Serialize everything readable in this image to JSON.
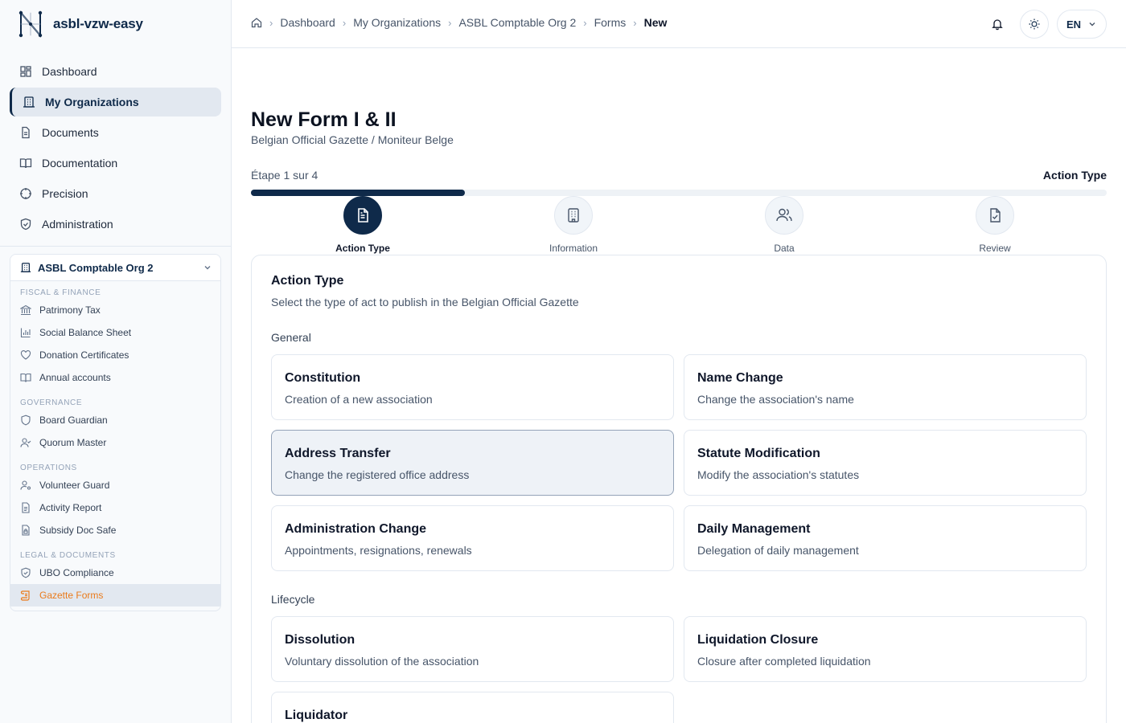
{
  "app": {
    "name": "asbl-vzw-easy"
  },
  "sidebar": {
    "nav": [
      {
        "label": "Dashboard",
        "icon": "grid-icon"
      },
      {
        "label": "My Organizations",
        "icon": "building-icon",
        "active": true
      },
      {
        "label": "Documents",
        "icon": "file-icon"
      },
      {
        "label": "Documentation",
        "icon": "book-icon"
      },
      {
        "label": "Precision",
        "icon": "crosshair-icon"
      },
      {
        "label": "Administration",
        "icon": "shield-icon"
      }
    ],
    "org": {
      "name": "ASBL Comptable Org 2",
      "sections": [
        {
          "label": "FISCAL & FINANCE",
          "items": [
            "Patrimony Tax",
            "Social Balance Sheet",
            "Donation Certificates",
            "Annual accounts"
          ]
        },
        {
          "label": "GOVERNANCE",
          "items": [
            "Board Guardian",
            "Quorum Master"
          ]
        },
        {
          "label": "OPERATIONS",
          "items": [
            "Volunteer Guard",
            "Activity Report",
            "Subsidy Doc Safe"
          ]
        },
        {
          "label": "LEGAL & DOCUMENTS",
          "items": [
            "UBO Compliance",
            "Gazette Forms"
          ]
        }
      ]
    }
  },
  "topbar": {
    "breadcrumb": [
      "Dashboard",
      "My Organizations",
      "ASBL Comptable Org 2",
      "Forms"
    ],
    "breadcrumb_current": "New",
    "language": "EN"
  },
  "page": {
    "title": "New Form I & II",
    "subtitle": "Belgian Official Gazette / Moniteur Belge",
    "step_text": "Étape 1 sur 4",
    "current_step_name": "Action Type",
    "progress": 0.25
  },
  "steps": [
    {
      "label": "Action Type",
      "active": true
    },
    {
      "label": "Information",
      "active": false
    },
    {
      "label": "Data",
      "active": false
    },
    {
      "label": "Review",
      "active": false
    }
  ],
  "card": {
    "title": "Action Type",
    "description": "Select the type of act to publish in the Belgian Official Gazette",
    "groups": [
      {
        "label": "General",
        "options": [
          {
            "title": "Constitution",
            "desc": "Creation of a new association"
          },
          {
            "title": "Name Change",
            "desc": "Change the association's name"
          },
          {
            "title": "Address Transfer",
            "desc": "Change the registered office address",
            "selected": true
          },
          {
            "title": "Statute Modification",
            "desc": "Modify the association's statutes"
          },
          {
            "title": "Administration Change",
            "desc": "Appointments, resignations, renewals"
          },
          {
            "title": "Daily Management",
            "desc": "Delegation of daily management"
          }
        ]
      },
      {
        "label": "Lifecycle",
        "options": [
          {
            "title": "Dissolution",
            "desc": "Voluntary dissolution of the association"
          },
          {
            "title": "Liquidation Closure",
            "desc": "Closure after completed liquidation"
          },
          {
            "title": "Liquidator",
            "desc": ""
          }
        ]
      }
    ]
  },
  "colors": {
    "brand": "#0f2a4a",
    "accent": "#ea7a1a",
    "selected_bg": "#eef2f7"
  }
}
